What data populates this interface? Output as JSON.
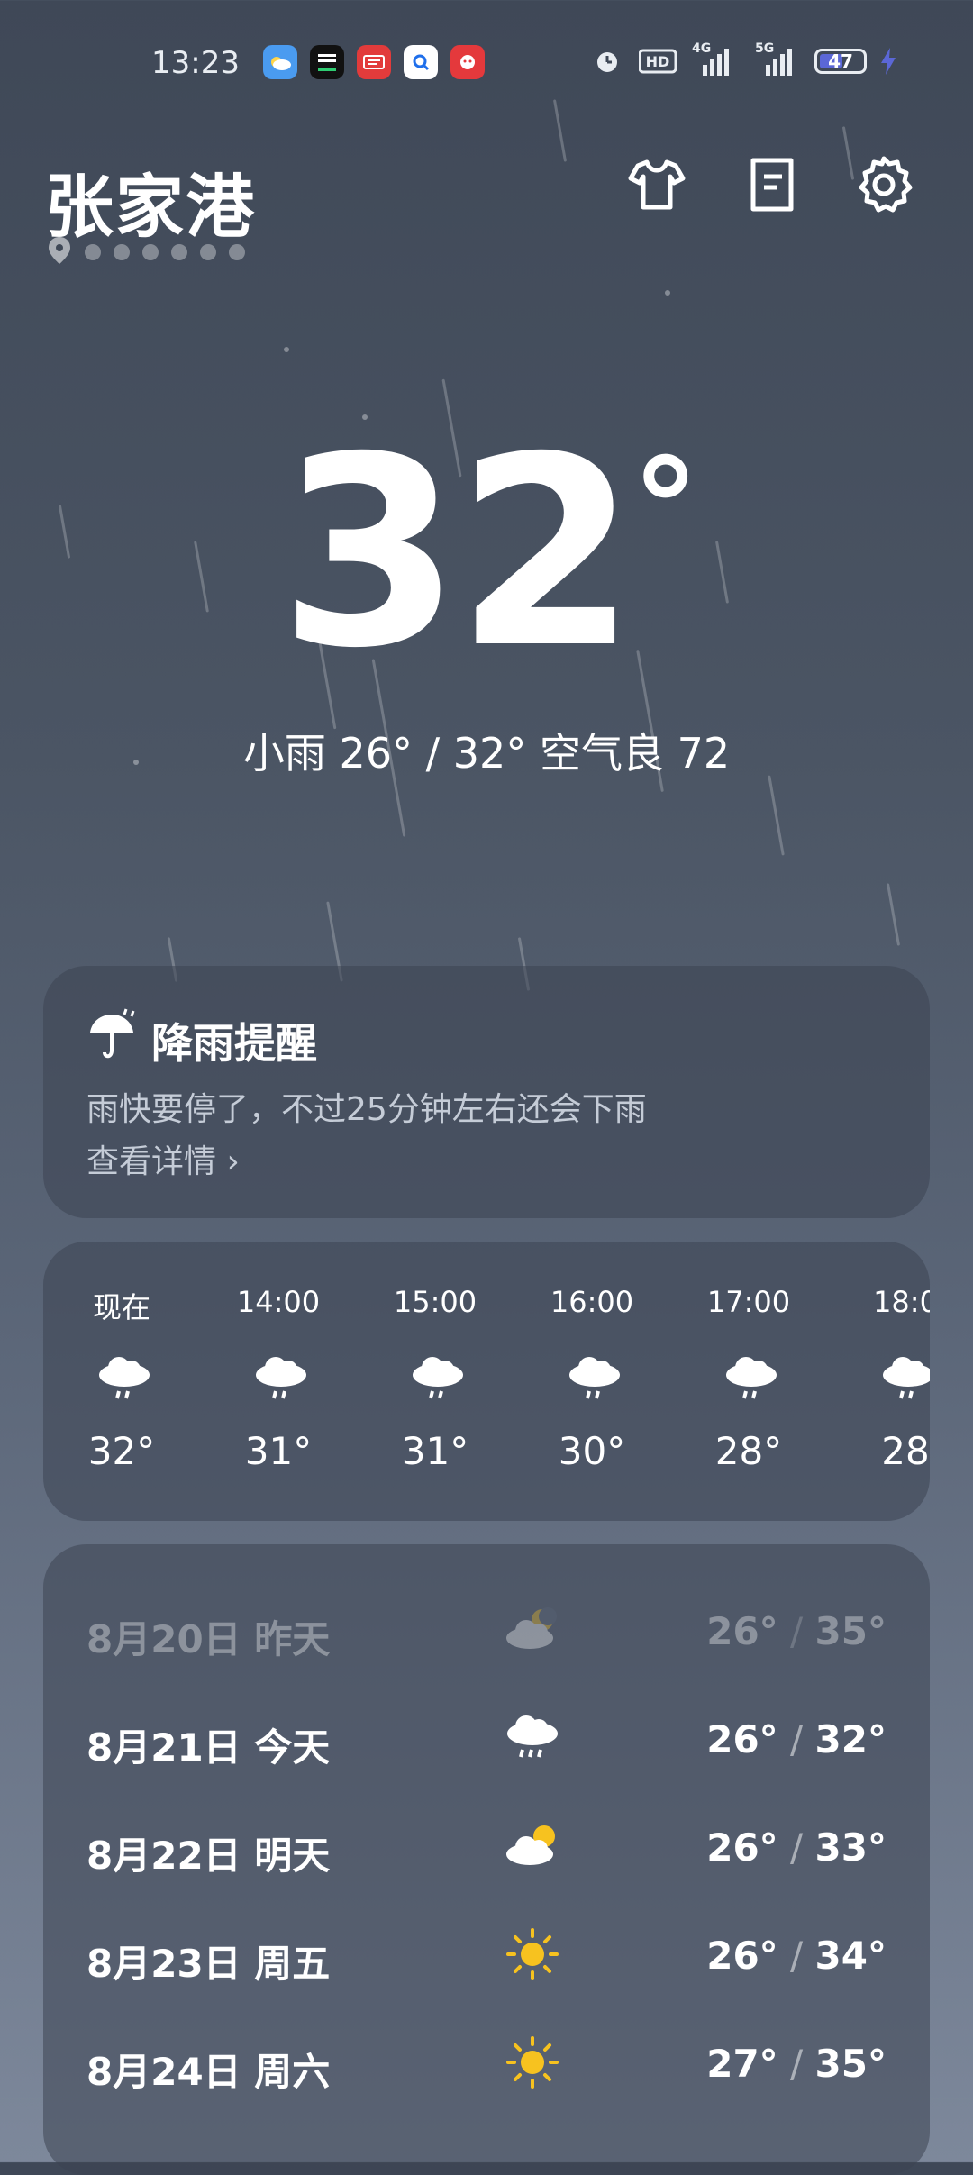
{
  "status_bar": {
    "time": "13:23",
    "battery": "47",
    "net1": "4G",
    "net2": "5G",
    "hd": "HD"
  },
  "header": {
    "city": "张家港",
    "icons": [
      "tshirt-icon",
      "document-icon",
      "gear-icon"
    ]
  },
  "current": {
    "temp": "32",
    "degree_symbol": "°",
    "summary": "小雨  26° / 32°  空气良 72"
  },
  "rain_alert": {
    "title": "降雨提醒",
    "desc": "雨快要停了，不过25分钟左右还会下雨",
    "link": "查看详情 ›"
  },
  "hourly": [
    {
      "time": "现在",
      "temp": "32°",
      "icon": "rain-cloud-icon"
    },
    {
      "time": "14:00",
      "temp": "31°",
      "icon": "rain-cloud-icon"
    },
    {
      "time": "15:00",
      "temp": "31°",
      "icon": "rain-cloud-icon"
    },
    {
      "time": "16:00",
      "temp": "30°",
      "icon": "rain-cloud-icon"
    },
    {
      "time": "17:00",
      "temp": "28°",
      "icon": "rain-cloud-icon"
    },
    {
      "time": "18:0",
      "temp": "28",
      "icon": "rain-cloud-icon"
    }
  ],
  "daily": [
    {
      "date": "8月20日  昨天",
      "low": "26°",
      "high": "35°",
      "icon": "cloud-moon-icon"
    },
    {
      "date": "8月21日  今天",
      "low": "26°",
      "high": "32°",
      "icon": "rain-cloud-icon"
    },
    {
      "date": "8月22日  明天",
      "low": "26°",
      "high": "33°",
      "icon": "cloud-sun-icon"
    },
    {
      "date": "8月23日  周五",
      "low": "26°",
      "high": "34°",
      "icon": "sun-icon"
    },
    {
      "date": "8月24日  周六",
      "low": "27°",
      "high": "35°",
      "icon": "sun-icon"
    }
  ],
  "colors": {
    "sun": "#f7c21f",
    "battery_fill": "#5b67d6",
    "bg_top": "#3f4857",
    "bg_bottom": "#7d889b"
  }
}
